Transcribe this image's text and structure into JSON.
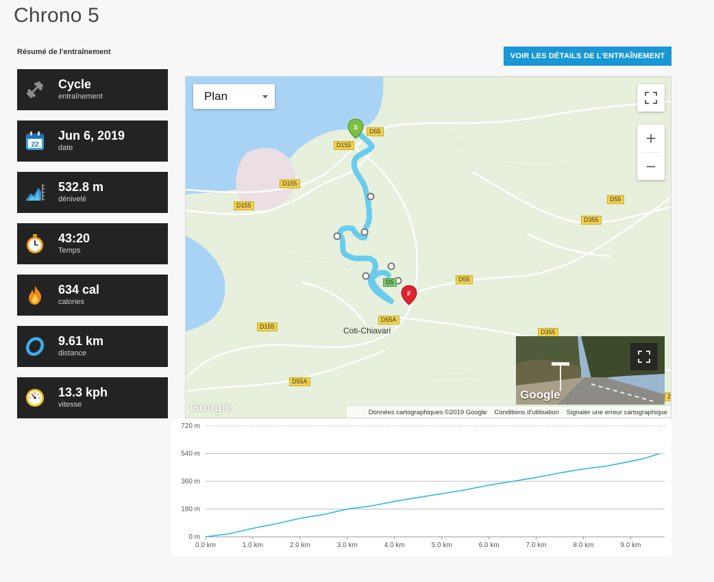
{
  "page": {
    "title": "Chrono 5"
  },
  "summary": {
    "heading": "Résumé de l'entraînement",
    "details_button": "VOIR LES DÉTAILS DE L'ENTRAÎNEMENT",
    "stats": [
      {
        "value": "Cycle",
        "label": "entraînement",
        "icon": "dumbbell-icon"
      },
      {
        "value": "Jun 6, 2019",
        "label": "date",
        "icon": "calendar-icon",
        "badge": "22"
      },
      {
        "value": "532.8 m",
        "label": "dénivelé",
        "icon": "elevation-icon"
      },
      {
        "value": "43:20",
        "label": "Temps",
        "icon": "stopwatch-icon"
      },
      {
        "value": "634 cal",
        "label": "calories",
        "icon": "flame-icon"
      },
      {
        "value": "9.61 km",
        "label": "distance",
        "icon": "distance-ring-icon"
      },
      {
        "value": "13.3 kph",
        "label": "vitesse",
        "icon": "speedometer-icon"
      }
    ]
  },
  "map": {
    "map_type": "Plan",
    "zoom_in": "+",
    "zoom_out": "−",
    "start_marker": "S",
    "finish_marker": "F",
    "town": "Coti-Chiavari",
    "roads": [
      "D55",
      "D155",
      "D155",
      "D155",
      "D55",
      "D355",
      "D55",
      "D55A",
      "D155",
      "D355",
      "D55A",
      "D5",
      "2"
    ],
    "google_logo": "Google",
    "streetview_logo": "Google",
    "attribution": {
      "data": "Données cartographiques ©2019 Google",
      "terms": "Conditions d'utilisation",
      "report": "Signaler une erreur cartographique"
    },
    "colors": {
      "route": "#5bc8ee",
      "water": "#a8d3f5",
      "land": "#e7efdd"
    }
  },
  "chart_data": {
    "type": "line",
    "series": [
      {
        "color": "#2bb5e8",
        "x": [
          0.0,
          0.5,
          1.0,
          1.5,
          2.0,
          2.5,
          3.0,
          3.5,
          4.0,
          4.5,
          5.0,
          5.5,
          6.0,
          6.5,
          7.0,
          7.5,
          8.0,
          8.5,
          9.0,
          9.3,
          9.61
        ],
        "y": [
          0,
          20,
          55,
          85,
          120,
          145,
          180,
          200,
          230,
          255,
          280,
          305,
          335,
          360,
          385,
          415,
          440,
          460,
          490,
          510,
          540
        ]
      }
    ],
    "y_ticks": [
      "0 m",
      "180 m",
      "360 m",
      "540 m",
      "720 m"
    ],
    "y_tick_values": [
      0,
      180,
      360,
      540,
      720
    ],
    "x_ticks": [
      "0.0 km",
      "1.0 km",
      "2.0 km",
      "3.0 km",
      "4.0 km",
      "5.0 km",
      "6.0 km",
      "7.0 km",
      "8.0 km",
      "9.0 km"
    ],
    "x_tick_values": [
      0,
      1,
      2,
      3,
      4,
      5,
      6,
      7,
      8,
      9
    ],
    "xlim": [
      0,
      9.72
    ],
    "ylim": [
      0,
      720
    ],
    "grid": true
  }
}
